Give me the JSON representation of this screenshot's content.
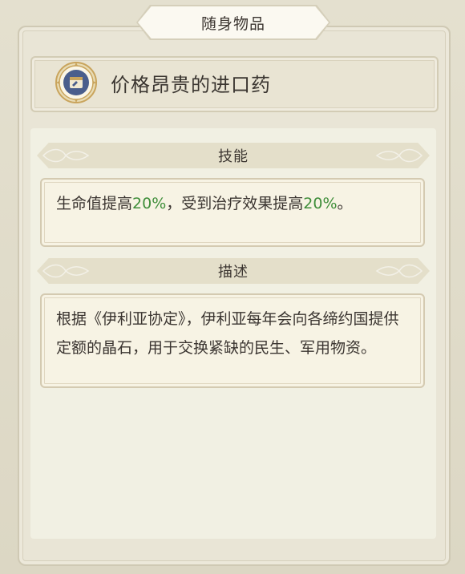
{
  "panel": {
    "title": "随身物品"
  },
  "item": {
    "icon": "medicine-bottle-icon",
    "name": "价格昂贵的进口药"
  },
  "skill": {
    "header": "技能",
    "text_before_1": "生命值提高",
    "value_1": "20%",
    "text_middle": "，受到治疗效果提高",
    "value_2": "20%",
    "text_after": "。"
  },
  "description": {
    "header": "描述",
    "text": "根据《伊利亚协定》，伊利亚每年会向各缔约国提供定额的晶石，用于交换紧缺的民生、军用物资。"
  },
  "colors": {
    "accent_green": "#3f8e3a",
    "text": "#3a3430",
    "icon_ring": "#c9a45c",
    "icon_core": "#4a5e8c"
  }
}
